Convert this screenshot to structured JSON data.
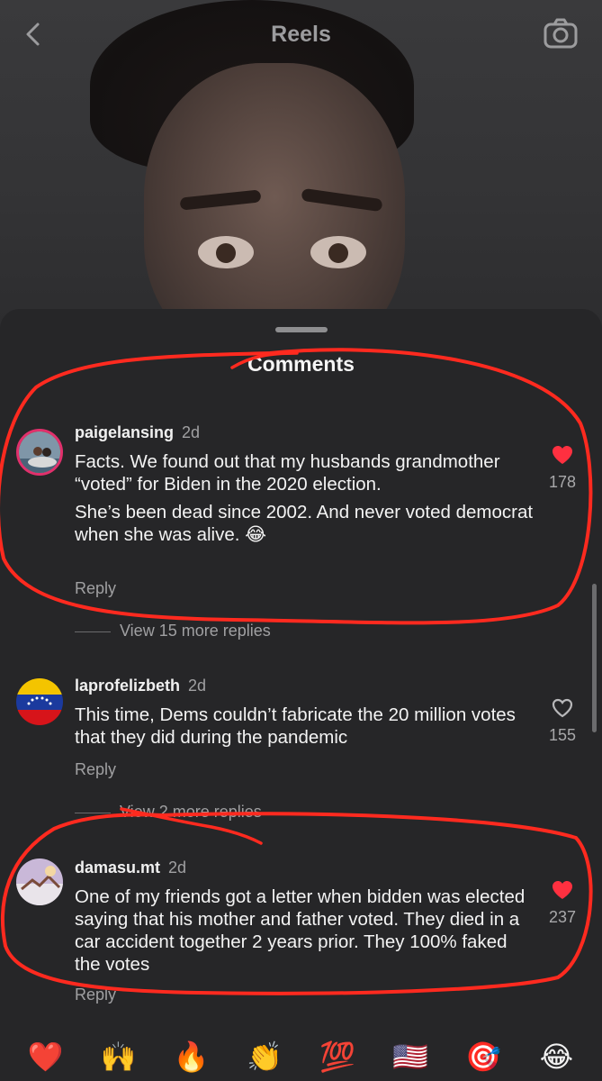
{
  "header": {
    "title": "Reels"
  },
  "sheet": {
    "title": "Comments"
  },
  "comments": [
    {
      "username": "paigelansing",
      "time": "2d",
      "paragraphs": [
        "Facts.  We found out that my husbands grandmother “voted” for Biden in the 2020 election.",
        "She’s been dead since 2002. And never voted democrat when she was alive. 😂"
      ],
      "reply_label": "Reply",
      "likes": "178",
      "liked": true,
      "view_more": "View 15 more replies"
    },
    {
      "username": "laprofelizbeth",
      "time": "2d",
      "paragraphs": [
        "This time, Dems couldn’t fabricate the 20 million votes that they did during the pandemic"
      ],
      "reply_label": "Reply",
      "likes": "155",
      "liked": false,
      "view_more": "View 2 more replies"
    },
    {
      "username": "damasu.mt",
      "time": "2d",
      "paragraphs": [
        "One of my friends got a letter when bidden was elected saying that his mother and father voted. They died in a car accident together 2 years prior. They 100% faked the votes"
      ],
      "reply_label": "Reply",
      "likes": "237",
      "liked": true
    }
  ],
  "emoji_bar": [
    "❤️",
    "🙌",
    "🔥",
    "👏",
    "💯",
    "🇺🇸",
    "🎯",
    "😂"
  ],
  "colors": {
    "like_red": "#ff3040",
    "annotation_red": "#ff2a1f",
    "sheet_bg": "#262628"
  }
}
